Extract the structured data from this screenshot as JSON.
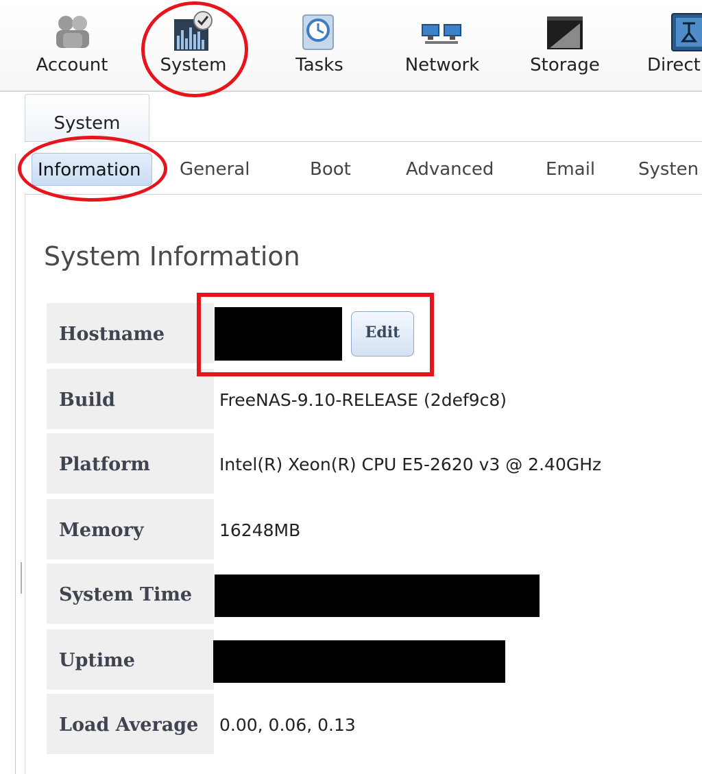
{
  "toolbar": {
    "items": [
      {
        "label": "Account",
        "icon": "account-icon"
      },
      {
        "label": "System",
        "icon": "system-icon"
      },
      {
        "label": "Tasks",
        "icon": "tasks-icon"
      },
      {
        "label": "Network",
        "icon": "network-icon"
      },
      {
        "label": "Storage",
        "icon": "storage-icon"
      },
      {
        "label": "Direct",
        "icon": "directory-icon"
      }
    ]
  },
  "tabs": {
    "top": "System",
    "sub": [
      "Information",
      "General",
      "Boot",
      "Advanced",
      "Email",
      "Systen"
    ],
    "active": "Information"
  },
  "main": {
    "title": "System Information",
    "edit_label": "Edit",
    "rows": [
      {
        "label": "Hostname",
        "value": ""
      },
      {
        "label": "Build",
        "value": "FreeNAS-9.10-RELEASE (2def9c8)"
      },
      {
        "label": "Platform",
        "value": "Intel(R) Xeon(R) CPU E5-2620 v3 @ 2.40GHz"
      },
      {
        "label": "Memory",
        "value": "16248MB"
      },
      {
        "label": "System Time",
        "value": ""
      },
      {
        "label": "Uptime",
        "value": ""
      },
      {
        "label": "Load Average",
        "value": "0.00, 0.06, 0.13"
      }
    ]
  },
  "colors": {
    "annotation": "#e8141b",
    "active_tab": "#c8dcf3",
    "label_bg": "#efefef"
  }
}
